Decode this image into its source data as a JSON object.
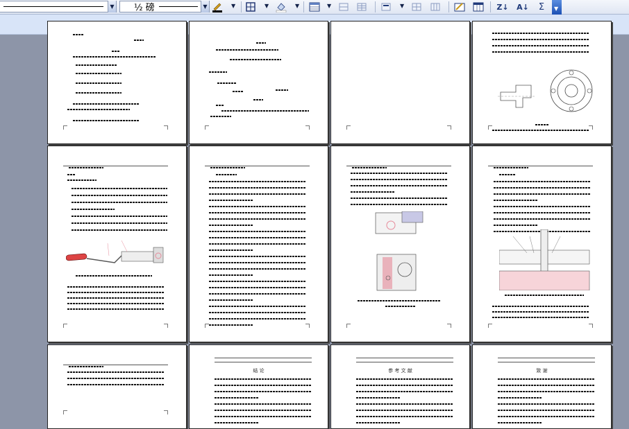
{
  "toolbar": {
    "font_size_value": "½ 磅",
    "line_style_icon": "line-style-icon",
    "pen_color_icon": "pen-color-icon",
    "borders_icon": "borders-icon",
    "shading_icon": "shading-icon",
    "insert_table_icon": "insert-table-icon",
    "merge_cells_icon": "merge-cells-icon",
    "split_cells_icon": "split-cells-icon",
    "align_icon": "align-icon",
    "distribute_rows_icon": "distribute-rows-icon",
    "distribute_cols_icon": "distribute-columns-icon",
    "autoformat_icon": "table-autoformat-icon",
    "sort_asc_label": "Z↓",
    "sort_desc_label": "A↓",
    "autosum_label": "Σ"
  },
  "pages": {
    "p10_title": "结 论",
    "p11_title": "参 考 文 献",
    "p12_title": "致 谢"
  }
}
